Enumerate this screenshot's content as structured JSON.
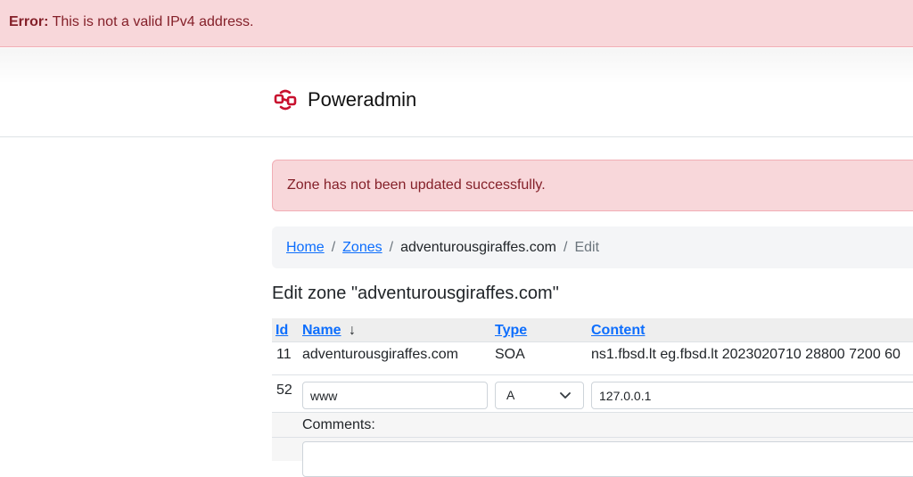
{
  "error_bar": {
    "label": "Error:",
    "message": "This is not a valid IPv4 address."
  },
  "header": {
    "brand": "Poweradmin",
    "logo_icon": "poweradmin-logo-icon",
    "accent_color": "#c8102e"
  },
  "alert": {
    "message": "Zone has not been updated successfully."
  },
  "breadcrumb": {
    "items": [
      {
        "label": "Home"
      },
      {
        "label": "Zones"
      },
      {
        "label": "adventurousgiraffes.com"
      },
      {
        "label": "Edit"
      }
    ],
    "separator": "/"
  },
  "page_title": "Edit zone \"adventurousgiraffes.com\"",
  "table": {
    "headers": {
      "id": "Id",
      "name": "Name",
      "name_sort": "↓",
      "type": "Type",
      "content": "Content"
    },
    "rows": [
      {
        "id": "11",
        "name": "adventurousgiraffes.com",
        "type": "SOA",
        "content": "ns1.fbsd.lt eg.fbsd.lt 2023020710 28800 7200 60"
      },
      {
        "id": "52",
        "name": "www",
        "type": "A",
        "content": "127.0.0.1"
      }
    ],
    "comments_label": "Comments:"
  }
}
